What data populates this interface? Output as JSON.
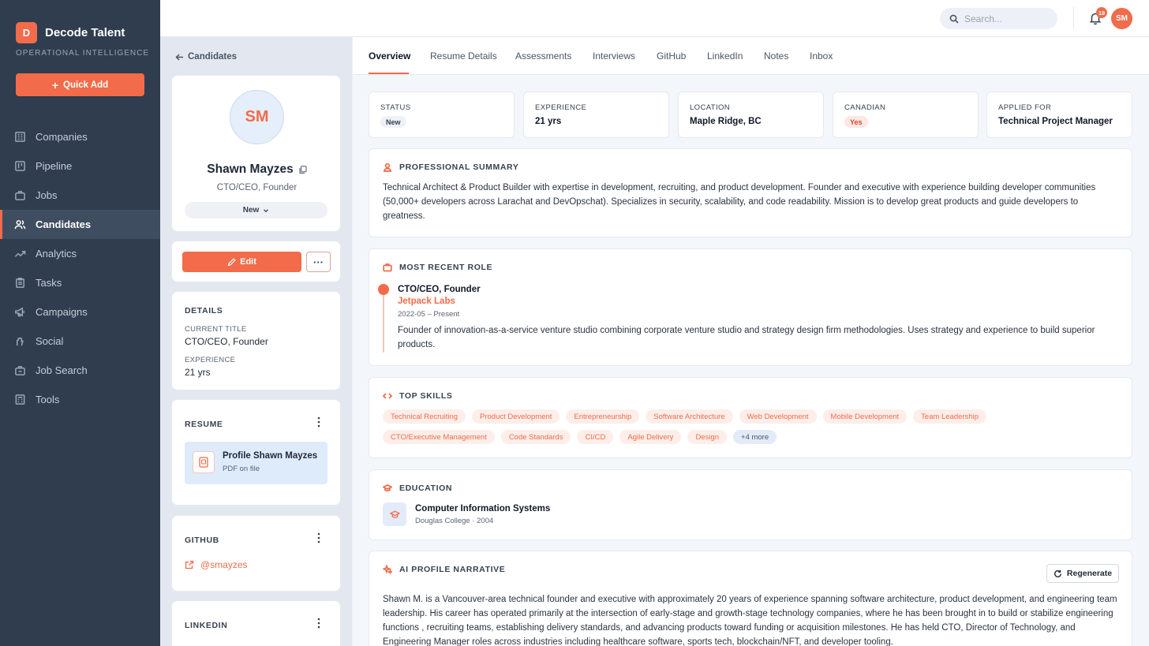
{
  "brand": {
    "logo_letter": "D",
    "name": "Decode Talent",
    "subtitle": "OPERATIONAL INTELLIGENCE",
    "accent": "#f26b4a"
  },
  "sidebar": {
    "quick_add_label": "Quick Add",
    "items": [
      {
        "label": "Companies",
        "icon": "building-icon"
      },
      {
        "label": "Pipeline",
        "icon": "kanban-icon"
      },
      {
        "label": "Jobs",
        "icon": "briefcase-icon"
      },
      {
        "label": "Candidates",
        "icon": "users-icon",
        "active": true
      },
      {
        "label": "Analytics",
        "icon": "trend-icon"
      },
      {
        "label": "Tasks",
        "icon": "clipboard-icon"
      },
      {
        "label": "Campaigns",
        "icon": "megaphone-icon"
      },
      {
        "label": "Social",
        "icon": "hand-icon"
      },
      {
        "label": "Job Search",
        "icon": "briefcase-search-icon"
      },
      {
        "label": "Tools",
        "icon": "calculator-icon"
      }
    ]
  },
  "topbar": {
    "search_placeholder": "Search...",
    "notification_count": "19",
    "user_initials": "SM"
  },
  "candidate": {
    "back_label": "Candidates",
    "initials": "SM",
    "name": "Shawn Mayzes",
    "title": "CTO/CEO, Founder",
    "status": "New",
    "edit_label": "Edit",
    "more_label": "···",
    "details": {
      "section_title": "DETAILS",
      "current_title_label": "CURRENT TITLE",
      "current_title": "CTO/CEO, Founder",
      "experience_label": "EXPERIENCE",
      "experience": "21 yrs"
    },
    "resume": {
      "section_title": "RESUME",
      "file_name": "Profile Shawn Mayzes",
      "file_sub": "PDF on file"
    },
    "github": {
      "section_title": "GITHUB",
      "handle": "@smayzes"
    },
    "linkedin": {
      "section_title": "LINKEDIN"
    }
  },
  "tabs": [
    "Overview",
    "Resume Details",
    "Assessments",
    "Interviews",
    "GitHub",
    "LinkedIn",
    "Notes",
    "Inbox"
  ],
  "stats": {
    "status": {
      "label": "STATUS",
      "value": "New"
    },
    "experience": {
      "label": "EXPERIENCE",
      "value": "21 yrs"
    },
    "location": {
      "label": "LOCATION",
      "value": "Maple Ridge, BC"
    },
    "canadian": {
      "label": "CANADIAN",
      "value": "Yes"
    },
    "applied_for": {
      "label": "APPLIED FOR",
      "value": "Technical Project Manager"
    }
  },
  "summary": {
    "title": "PROFESSIONAL SUMMARY",
    "text": "Technical Architect & Product Builder with expertise in development, recruiting, and product development. Founder and executive with experience building developer communities (50,000+ developers across Larachat and DevOpschat). Specializes in security, scalability, and code readability. Mission is to develop great products and guide developers to greatness."
  },
  "recent_role": {
    "title": "MOST RECENT ROLE",
    "role": "CTO/CEO, Founder",
    "company": "Jetpack Labs",
    "dates": "2022-05 – Present",
    "description": "Founder of innovation-as-a-service venture studio combining corporate venture studio and strategy design firm methodologies. Uses strategy and experience to build superior products."
  },
  "skills": {
    "title": "TOP SKILLS",
    "row1": [
      "Technical Recruiting",
      "Product Development",
      "Entrepreneurship",
      "Software Architecture",
      "Web Development",
      "Mobile Development",
      "Team Leadership"
    ],
    "row2": [
      "CTO/Executive Management",
      "Code Standards",
      "CI/CD",
      "Agile Delivery",
      "Design"
    ],
    "more_label": "+4 more"
  },
  "education": {
    "title": "EDUCATION",
    "degree": "Computer Information Systems",
    "school_line": "Douglas College · 2004"
  },
  "narrative": {
    "title": "AI PROFILE NARRATIVE",
    "regenerate_label": "Regenerate",
    "text": "Shawn M. is a Vancouver-area technical founder and executive with approximately 20 years of experience spanning software architecture, product development, and engineering team leadership. His career has operated primarily at the intersection of early-stage and growth-stage technology companies, where he has been brought in to build or stabilize engineering functions ,  recruiting teams, establishing delivery standards, and advancing products toward funding or acquisition milestones. He has held CTO, Director of Technology, and Engineering Manager roles across industries including healthcare software, sports tech, blockchain/NFT, and developer tooling."
  }
}
